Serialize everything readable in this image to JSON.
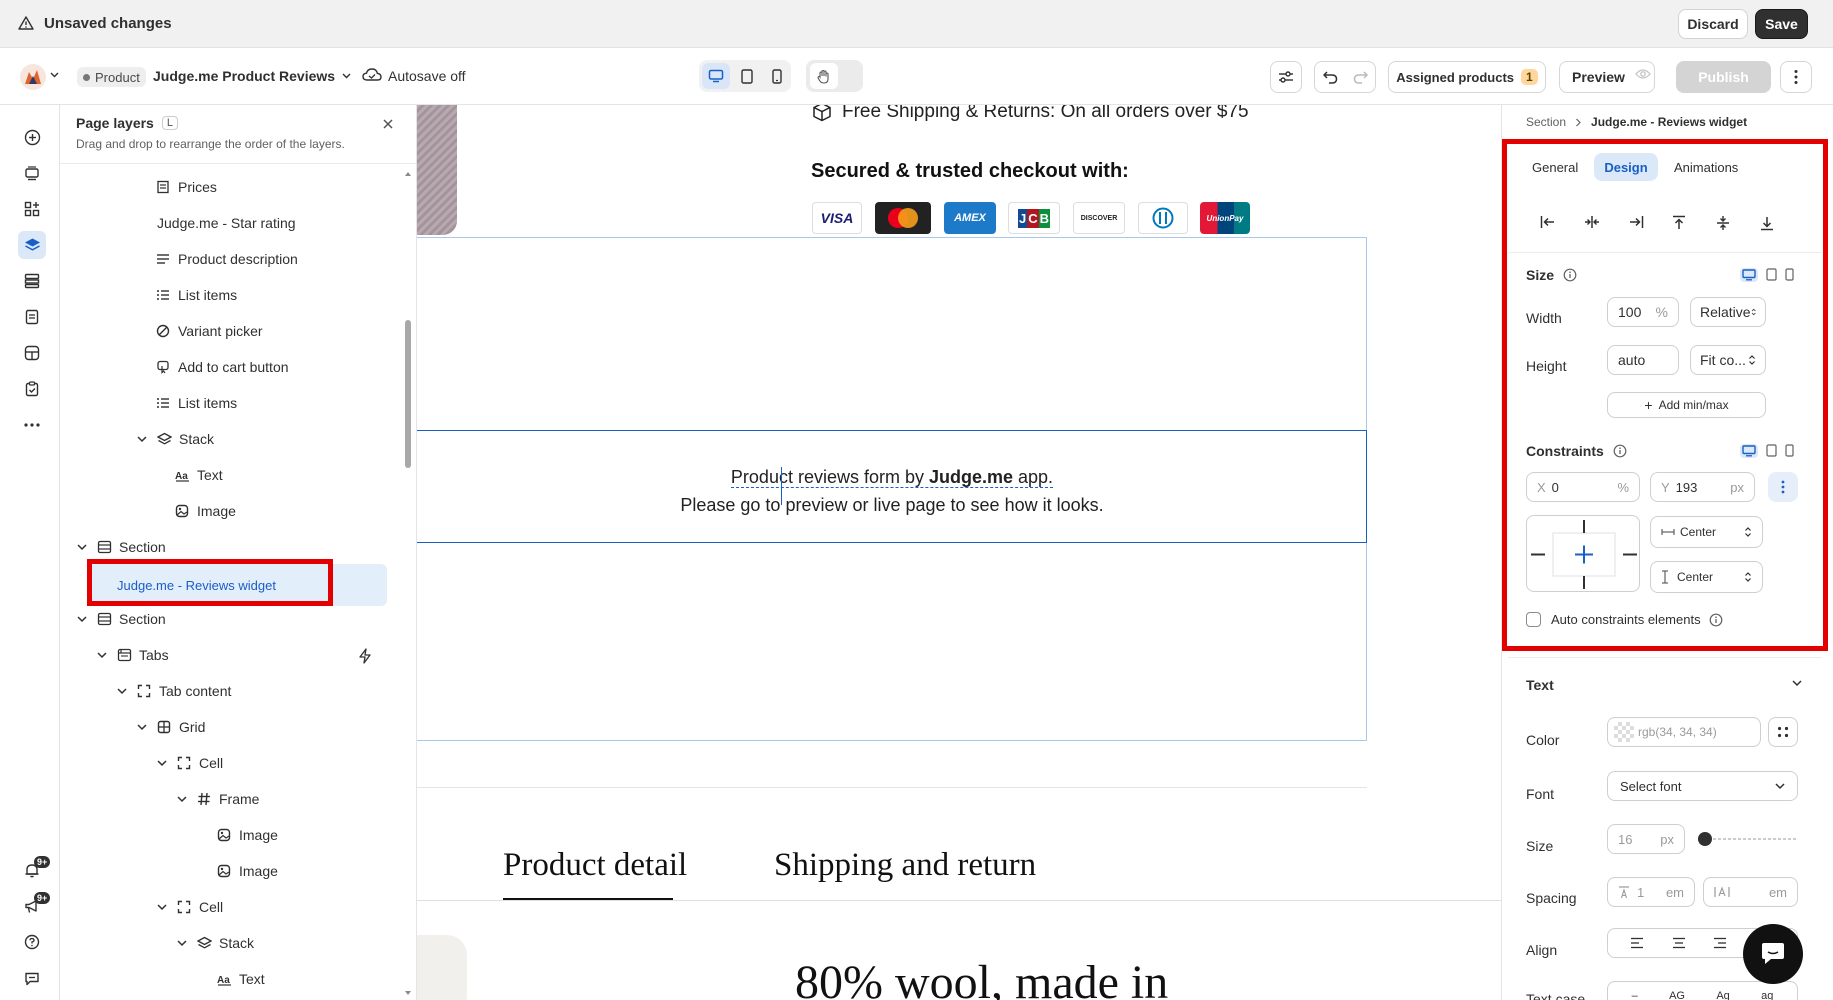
{
  "topbar": {
    "status": "Unsaved changes",
    "discard": "Discard",
    "save": "Save"
  },
  "toolbar": {
    "page_type": "Product",
    "page_name": "Judge.me Product Reviews",
    "autosave": "Autosave off",
    "assigned_products": "Assigned products",
    "assigned_count": "1",
    "preview": "Preview",
    "publish": "Publish"
  },
  "rail": {
    "notif_badge": "9+",
    "announce_badge": "9+"
  },
  "layers": {
    "title": "Page layers",
    "shortcut": "L",
    "subtitle": "Drag and drop to rearrange the order of the layers.",
    "items": [
      {
        "label": "Prices",
        "icon": "prices-icon"
      },
      {
        "label": "Judge.me - Star rating",
        "icon": ""
      },
      {
        "label": "Product description",
        "icon": "description-icon"
      },
      {
        "label": "List items",
        "icon": "list-icon"
      },
      {
        "label": "Variant picker",
        "icon": "variant-icon"
      },
      {
        "label": "Add to cart button",
        "icon": "cart-button-icon"
      },
      {
        "label": "List items",
        "icon": "list-icon"
      },
      {
        "label": "Stack",
        "icon": "stack-icon"
      },
      {
        "label": "Text",
        "icon": "text-icon"
      },
      {
        "label": "Image",
        "icon": "image-icon"
      },
      {
        "label": "Section",
        "icon": "section-icon"
      },
      {
        "label": "Judge.me - Reviews widget",
        "icon": ""
      },
      {
        "label": "Section",
        "icon": "section-icon"
      },
      {
        "label": "Tabs",
        "icon": "tabs-icon"
      },
      {
        "label": "Tab content",
        "icon": "frame-icon"
      },
      {
        "label": "Grid",
        "icon": "grid-icon"
      },
      {
        "label": "Cell",
        "icon": "frame-icon"
      },
      {
        "label": "Frame",
        "icon": "hash-icon"
      },
      {
        "label": "Image",
        "icon": "image-icon"
      },
      {
        "label": "Image",
        "icon": "image-icon"
      },
      {
        "label": "Cell",
        "icon": "frame-icon"
      },
      {
        "label": "Stack",
        "icon": "stack-icon"
      },
      {
        "label": "Text",
        "icon": "text-icon"
      }
    ]
  },
  "canvas": {
    "shipping": "Free Shipping & Returns: On all orders over $75",
    "secured": "Secured & trusted checkout with:",
    "payments": [
      "VISA",
      "Mastercard",
      "AMEX",
      "JCB",
      "DISCOVER",
      "Diners",
      "UnionPay"
    ],
    "review_line1_a": "Product reviews form by ",
    "review_line1_b": "Judge.me",
    "review_line1_c": " app.",
    "review_line2": "Please go to preview or live page to see how it looks.",
    "tab1": "Product detail",
    "tab2": "Shipping and return",
    "heading": "80% wool, made in"
  },
  "panel": {
    "breadcrumb_parent": "Section",
    "breadcrumb_current": "Judge.me - Reviews widget",
    "tabs": [
      "General",
      "Design",
      "Animations"
    ],
    "size_label": "Size",
    "width_label": "Width",
    "width_value": "100",
    "width_unit": "%",
    "width_mode": "Relative",
    "height_label": "Height",
    "height_value": "auto",
    "height_mode": "Fit co...",
    "add_minmax": "Add min/max",
    "constraints_label": "Constraints",
    "x_label": "X",
    "x_value": "0",
    "x_unit": "%",
    "y_label": "Y",
    "y_value": "193",
    "y_unit": "px",
    "h_align": "Center",
    "v_align": "Center",
    "auto_constraints": "Auto constraints elements",
    "text_section": "Text",
    "color_label": "Color",
    "color_value": "rgb(34, 34, 34)",
    "font_label": "Font",
    "font_value": "Select font",
    "fsize_label": "Size",
    "fsize_value": "16",
    "fsize_unit": "px",
    "spacing_label": "Spacing",
    "line_value": "1",
    "line_unit": "em",
    "letter_unit": "em",
    "align_label": "Align",
    "case_label": "Text case",
    "case_options": [
      "AG",
      "Ag",
      "ag"
    ]
  },
  "colors": {
    "accent": "#1a5ec7",
    "highlight": "#e30000",
    "selected_bg": "#e3eefb"
  }
}
